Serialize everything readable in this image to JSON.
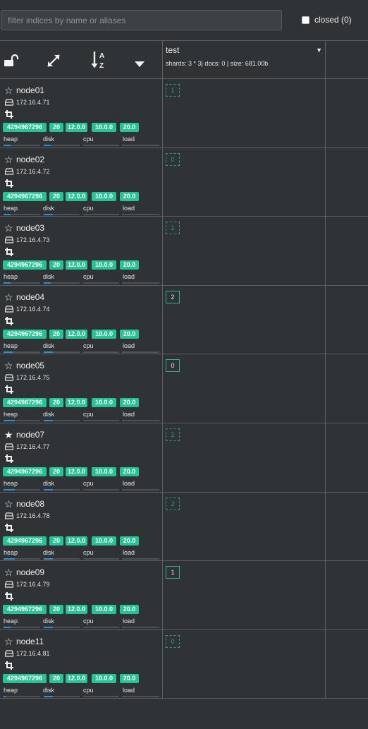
{
  "topbar": {
    "filter_placeholder": "filter indices by name or aliases",
    "closed_label": "closed (0)"
  },
  "toolbar": {
    "icons": [
      "unlock-icon",
      "expand-icon",
      "sort-alpha-icon",
      "caret-down-icon"
    ]
  },
  "index": {
    "name": "test",
    "meta": "shards: 3 * 3| docs: 0 | size: 681.00b"
  },
  "colors": {
    "background": "#303335",
    "badge": "#27c295",
    "shard_border": "#2bb48b",
    "bar_fill": "#2f8fd8"
  },
  "nodes": [
    {
      "name": "node01",
      "ip": "172.16.4.71",
      "master": false,
      "badges": [
        "4294967296",
        "20",
        "12.0.0",
        "10.0.0",
        "20.0"
      ],
      "metrics": [
        "heap",
        "disk",
        "cpu",
        "load"
      ],
      "usage": [
        0.2,
        0.2,
        0.0,
        0.02
      ],
      "shard": "1",
      "shard_type": "replica"
    },
    {
      "name": "node02",
      "ip": "172.16.4.72",
      "master": false,
      "badges": [
        "4294967296",
        "20",
        "12.0.0",
        "10.0.0",
        "20.0"
      ],
      "metrics": [
        "heap",
        "disk",
        "cpu",
        "load"
      ],
      "usage": [
        0.2,
        0.25,
        0.0,
        0.02
      ],
      "shard": "0",
      "shard_type": "replica"
    },
    {
      "name": "node03",
      "ip": "172.16.4.73",
      "master": false,
      "badges": [
        "4294967296",
        "20",
        "12.0.0",
        "10.0.0",
        "20.0"
      ],
      "metrics": [
        "heap",
        "disk",
        "cpu",
        "load"
      ],
      "usage": [
        0.2,
        0.2,
        0.0,
        0.02
      ],
      "shard": "1",
      "shard_type": "replica"
    },
    {
      "name": "node04",
      "ip": "172.16.4.74",
      "master": false,
      "badges": [
        "4294967296",
        "20",
        "12.0.0",
        "10.0.0",
        "20.0"
      ],
      "metrics": [
        "heap",
        "disk",
        "cpu",
        "load"
      ],
      "usage": [
        0.25,
        0.25,
        0.0,
        0.02
      ],
      "shard": "2",
      "shard_type": "primary"
    },
    {
      "name": "node05",
      "ip": "172.16.4.75",
      "master": false,
      "badges": [
        "4294967296",
        "20",
        "12.0.0",
        "10.0.0",
        "20.0"
      ],
      "metrics": [
        "heap",
        "disk",
        "cpu",
        "load"
      ],
      "usage": [
        0.3,
        0.25,
        0.0,
        0.02
      ],
      "shard": "0",
      "shard_type": "primary"
    },
    {
      "name": "node07",
      "ip": "172.16.4.77",
      "master": true,
      "badges": [
        "4294967296",
        "20",
        "12.0.0",
        "10.0.0",
        "20.0"
      ],
      "metrics": [
        "heap",
        "disk",
        "cpu",
        "load"
      ],
      "usage": [
        0.3,
        0.25,
        0.0,
        0.02
      ],
      "shard": "2",
      "shard_type": "replica"
    },
    {
      "name": "node08",
      "ip": "172.16.4.78",
      "master": false,
      "badges": [
        "4294967296",
        "20",
        "12.0.0",
        "10.0.0",
        "20.0"
      ],
      "metrics": [
        "heap",
        "disk",
        "cpu",
        "load"
      ],
      "usage": [
        0.3,
        0.25,
        0.0,
        0.02
      ],
      "shard": "2",
      "shard_type": "replica"
    },
    {
      "name": "node09",
      "ip": "172.16.4.79",
      "master": false,
      "badges": [
        "4294967296",
        "20",
        "12.0.0",
        "10.0.0",
        "20.0"
      ],
      "metrics": [
        "heap",
        "disk",
        "cpu",
        "load"
      ],
      "usage": [
        0.2,
        0.25,
        0.0,
        0.02
      ],
      "shard": "1",
      "shard_type": "primary"
    },
    {
      "name": "node11",
      "ip": "172.16.4.81",
      "master": false,
      "badges": [
        "4294967296",
        "20",
        "12.0.0",
        "10.0.0",
        "20.0"
      ],
      "metrics": [
        "heap",
        "disk",
        "cpu",
        "load"
      ],
      "usage": [
        0.05,
        0.25,
        0.0,
        0.02
      ],
      "shard": "0",
      "shard_type": "replica"
    }
  ]
}
